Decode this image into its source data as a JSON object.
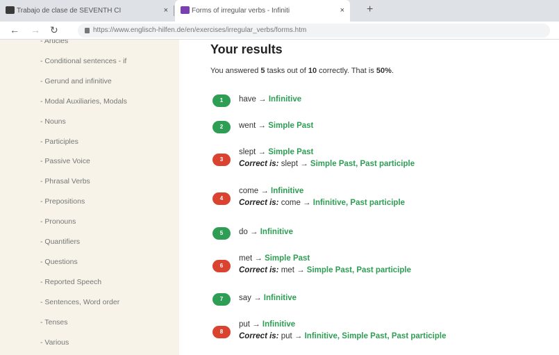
{
  "browser": {
    "tab1_title": "Trabajo de clase de SEVENTH CI",
    "tab1_close": "×",
    "tab2_title": "Forms of irregular verbs - Infiniti",
    "tab2_close": "×",
    "new_tab": "+",
    "url_host": "https://www.englisch-hilfen.de",
    "url_path": "/en/exercises/irregular_verbs/forms.htm"
  },
  "sidebar": {
    "items": [
      "- Articles",
      "- Conditional sentences - if",
      "- Gerund and infinitive",
      "- Modal Auxiliaries, Modals",
      "- Nouns",
      "- Participles",
      "- Passive Voice",
      "- Phrasal Verbs",
      "- Prepositions",
      "- Pronouns",
      "- Quantifiers",
      "- Questions",
      "- Reported Speech",
      "- Sentences, Word order",
      "- Tenses",
      "- Various"
    ]
  },
  "main": {
    "title": "Your results",
    "summary_prefix": "You answered ",
    "correct_count": "5",
    "summary_mid": " tasks out of ",
    "total_count": "10",
    "summary_mid2": " correctly. That is ",
    "percent": "50%",
    "summary_end": ".",
    "correct_label": "Correct is:",
    "results": [
      {
        "num": "1",
        "status": "correct",
        "verb": "have",
        "answer": "Infinitive"
      },
      {
        "num": "2",
        "status": "correct",
        "verb": "went",
        "answer": "Simple Past"
      },
      {
        "num": "3",
        "status": "wrong",
        "verb": "slept",
        "answer": "Simple Past",
        "correct": "Simple Past, Past participle"
      },
      {
        "num": "4",
        "status": "wrong",
        "verb": "come",
        "answer": "Infinitive",
        "correct": "Infinitive, Past participle"
      },
      {
        "num": "5",
        "status": "correct",
        "verb": "do",
        "answer": "Infinitive"
      },
      {
        "num": "6",
        "status": "wrong",
        "verb": "met",
        "answer": "Simple Past",
        "correct": "Simple Past, Past participle"
      },
      {
        "num": "7",
        "status": "correct",
        "verb": "say",
        "answer": "Infinitive"
      },
      {
        "num": "8",
        "status": "wrong",
        "verb": "put",
        "answer": "Infinitive",
        "correct": "Infinitive, Simple Past, Past participle"
      }
    ]
  },
  "colors": {
    "correct": "#2e9e54",
    "wrong": "#d9432f",
    "sidebar_bg": "#f7f3e8"
  }
}
